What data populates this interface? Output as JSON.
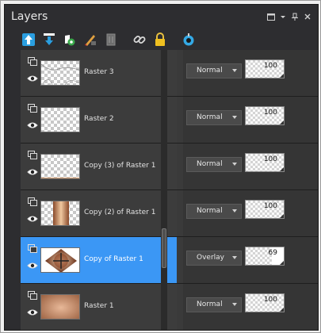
{
  "panel": {
    "title": "Layers",
    "window_buttons": [
      "restore-icon",
      "dropdown-icon",
      "pin-icon",
      "close-icon"
    ]
  },
  "toolbar": {
    "tools": [
      "new-layer-up-icon",
      "new-layer-down-icon",
      "visibility-icon",
      "brush-edit-icon",
      "delete-layer-icon",
      "link-icon",
      "lock-icon",
      "mask-icon"
    ]
  },
  "layers": [
    {
      "name": "Raster 3",
      "blend": "Normal",
      "opacity": "100",
      "opacity_level": 1.0,
      "selected": false
    },
    {
      "name": "Raster 2",
      "blend": "Normal",
      "opacity": "100",
      "opacity_level": 1.0,
      "selected": false
    },
    {
      "name": "Copy (3) of Raster 1",
      "blend": "Normal",
      "opacity": "100",
      "opacity_level": 1.0,
      "selected": false
    },
    {
      "name": "Copy (2) of Raster 1",
      "blend": "Normal",
      "opacity": "100",
      "opacity_level": 1.0,
      "selected": false
    },
    {
      "name": "Copy of Raster 1",
      "blend": "Overlay",
      "opacity": "69",
      "opacity_level": 0.69,
      "selected": true
    },
    {
      "name": "Raster 1",
      "blend": "Normal",
      "opacity": "100",
      "opacity_level": 1.0,
      "selected": false
    }
  ],
  "colors": {
    "selection": "#3b97f5",
    "panel_bg": "#2d2d30",
    "accent_icon": "#34a9e6"
  }
}
